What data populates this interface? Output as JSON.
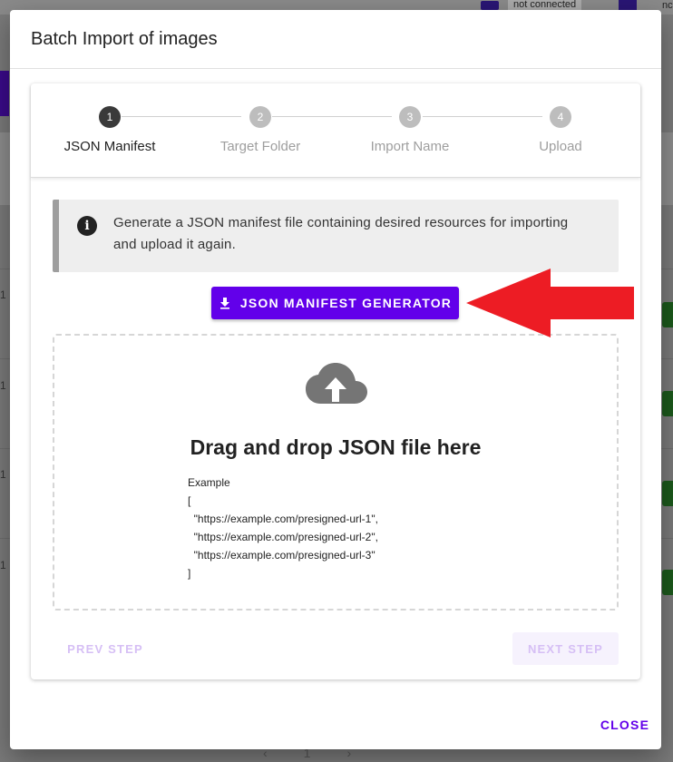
{
  "background": {
    "status_text": "not connected",
    "status_text_2": "nc",
    "rows": [
      "1",
      "1",
      "1",
      "1"
    ],
    "pager_current": "1"
  },
  "modal": {
    "title": "Batch Import of images",
    "close_label": "CLOSE"
  },
  "stepper": {
    "steps": [
      {
        "number": "1",
        "label": "JSON Manifest",
        "active": true
      },
      {
        "number": "2",
        "label": "Target Folder",
        "active": false
      },
      {
        "number": "3",
        "label": "Import Name",
        "active": false
      },
      {
        "number": "4",
        "label": "Upload",
        "active": false
      }
    ]
  },
  "alert": {
    "icon": "info-icon",
    "text": "Generate a JSON manifest file containing desired resources for importing and upload it again."
  },
  "generator_button": {
    "icon": "download-icon",
    "label": "JSON MANIFEST GENERATOR"
  },
  "dropzone": {
    "icon": "cloud-upload-icon",
    "title": "Drag and drop JSON file here",
    "example_label": "Example",
    "example_lines": [
      "[",
      "  \"https://example.com/presigned-url-1\",",
      "  \"https://example.com/presigned-url-2\",",
      "  \"https://example.com/presigned-url-3\"",
      "]"
    ]
  },
  "navigation": {
    "prev_label": "PREV STEP",
    "next_label": "NEXT STEP"
  },
  "colors": {
    "accent": "#6200ea",
    "annotation_arrow": "#ed1c24"
  }
}
